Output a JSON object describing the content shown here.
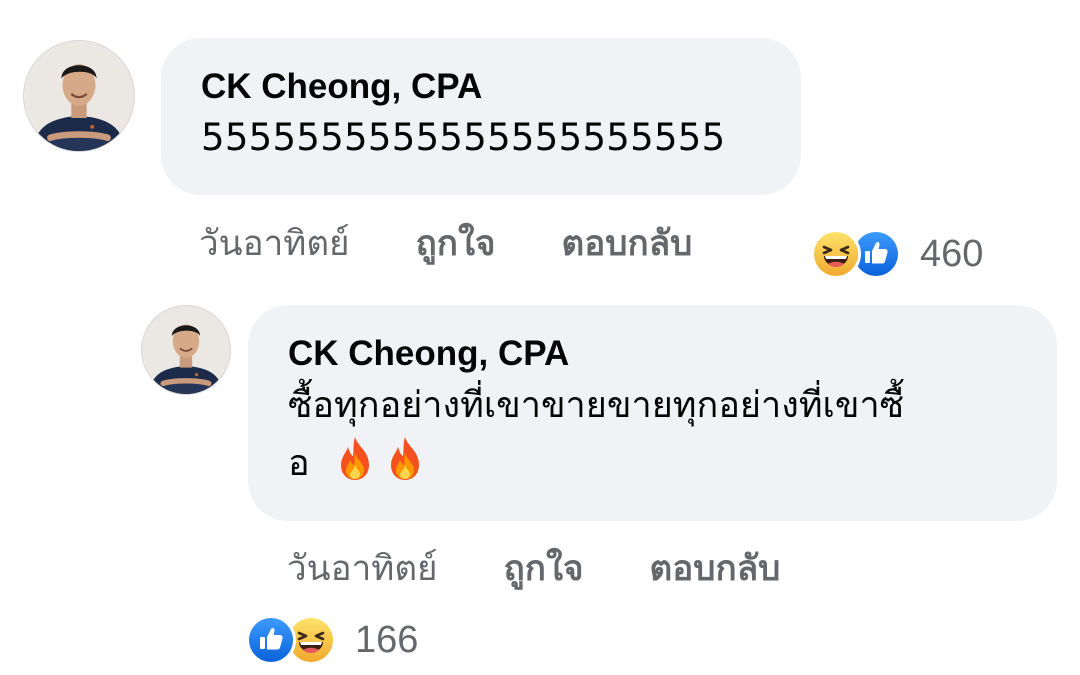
{
  "comments": [
    {
      "author": "CK Cheong, CPA",
      "text": "5555555555555555555555",
      "time": "วันอาทิตย์",
      "like_label": "ถูกใจ",
      "reply_label": "ตอบกลับ",
      "reactions": [
        "haha-icon",
        "like-icon"
      ],
      "reaction_count": "460"
    },
    {
      "author": "CK Cheong, CPA",
      "text_line1": "ซื้อทุกอย่างที่เขาขายขายทุกอย่างที่เขาซื้",
      "text_line2": "อ",
      "emoji": [
        "fire-emoji",
        "fire-emoji"
      ],
      "time": "วันอาทิตย์",
      "like_label": "ถูกใจ",
      "reply_label": "ตอบกลับ",
      "reactions": [
        "like-icon",
        "haha-icon"
      ],
      "reaction_count": "166"
    }
  ],
  "colors": {
    "bubble_bg": "#f0f2f5",
    "meta_text": "#65676b",
    "like_blue": "#1877f2",
    "haha_yellow": "#f7c948"
  }
}
